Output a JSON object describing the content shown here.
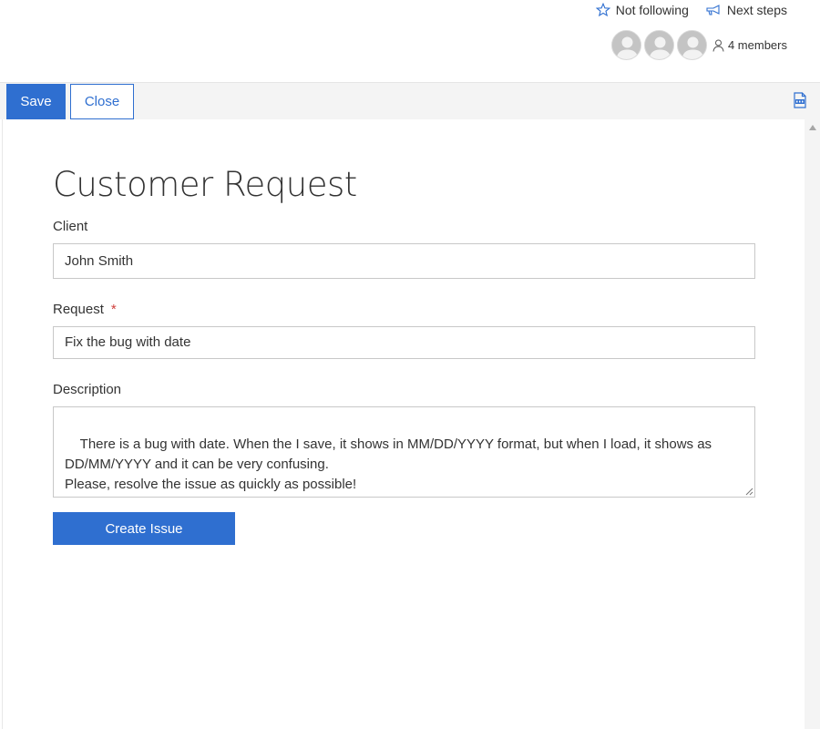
{
  "header": {
    "follow_label": "Not following",
    "next_steps_label": "Next steps",
    "members_label": "4 members",
    "follow_icon": "star-outline-icon",
    "next_steps_icon": "megaphone-icon",
    "member_icon": "person-icon"
  },
  "toolbar": {
    "save_label": "Save",
    "close_label": "Close",
    "pdf_icon": "pdf-icon"
  },
  "form": {
    "title": "Customer Request",
    "client_label": "Client",
    "client_value": "John Smith",
    "request_label": "Request",
    "request_required": "*",
    "request_value": "Fix the bug with date",
    "description_label": "Description",
    "description_value": "There is a bug with date. When the I save, it shows in MM/DD/YYYY format, but when I load, it shows as DD/MM/YYYY and it can be very confusing.\nPlease, resolve the issue as quickly as possible!",
    "create_label": "Create Issue"
  },
  "colors": {
    "accent": "#2f6fd0",
    "required": "#d0403d",
    "toolbar_bg": "#f4f4f4"
  }
}
